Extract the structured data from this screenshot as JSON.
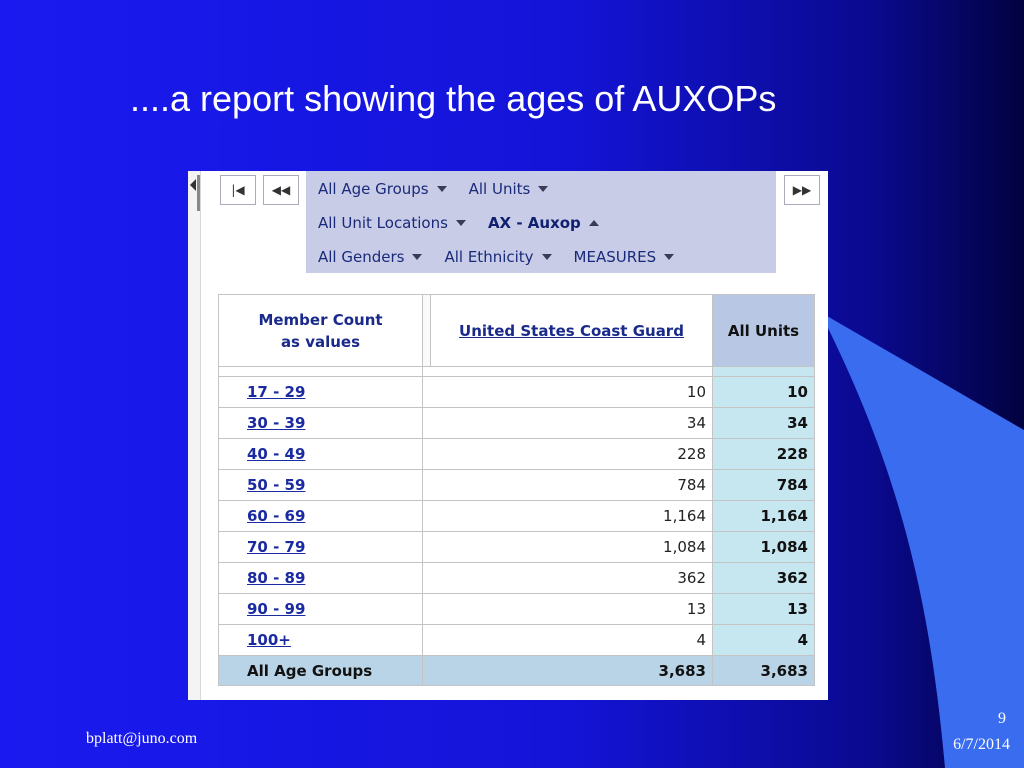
{
  "slide": {
    "title": "....a report showing the ages of AUXOPs",
    "footer_email": "bplatt@juno.com",
    "page_number": "9",
    "date": "6/7/2014"
  },
  "colors": {
    "background": "#1414d8",
    "accent_wedge": "#3a6cf0",
    "filter_panel": "#c9cce6",
    "all_units_col": "#c6e6f0"
  },
  "nav": {
    "first_icon": "first-page-icon",
    "prev_icon": "previous-page-icon",
    "next_icon": "next-page-icon"
  },
  "filters": {
    "rows": [
      [
        {
          "label": "All Age Groups",
          "bold": false,
          "caret": "down"
        },
        {
          "label": "All Units",
          "bold": false,
          "caret": "down"
        }
      ],
      [
        {
          "label": "All Unit Locations",
          "bold": false,
          "caret": "down"
        },
        {
          "label": "AX - Auxop",
          "bold": true,
          "caret": "up"
        }
      ],
      [
        {
          "label": "All Genders",
          "bold": false,
          "caret": "down"
        },
        {
          "label": "All Ethnicity",
          "bold": false,
          "caret": "down"
        },
        {
          "label": "MEASURES",
          "bold": false,
          "caret": "down"
        }
      ]
    ]
  },
  "table": {
    "header_label_line1": "Member Count",
    "header_label_line2": "as values",
    "col_uscg": "United States Coast Guard",
    "col_all": "All Units",
    "rows": [
      {
        "label": "17 - 29",
        "uscg": "10",
        "all": "10"
      },
      {
        "label": "30 - 39",
        "uscg": "34",
        "all": "34"
      },
      {
        "label": "40 - 49",
        "uscg": "228",
        "all": "228"
      },
      {
        "label": "50 - 59",
        "uscg": "784",
        "all": "784"
      },
      {
        "label": "60 - 69",
        "uscg": "1,164",
        "all": "1,164"
      },
      {
        "label": "70 - 79",
        "uscg": "1,084",
        "all": "1,084"
      },
      {
        "label": "80 - 89",
        "uscg": "362",
        "all": "362"
      },
      {
        "label": "90 - 99",
        "uscg": "13",
        "all": "13"
      },
      {
        "label": "100+",
        "uscg": "4",
        "all": "4"
      }
    ],
    "total": {
      "label": "All Age Groups",
      "uscg": "3,683",
      "all": "3,683"
    }
  }
}
